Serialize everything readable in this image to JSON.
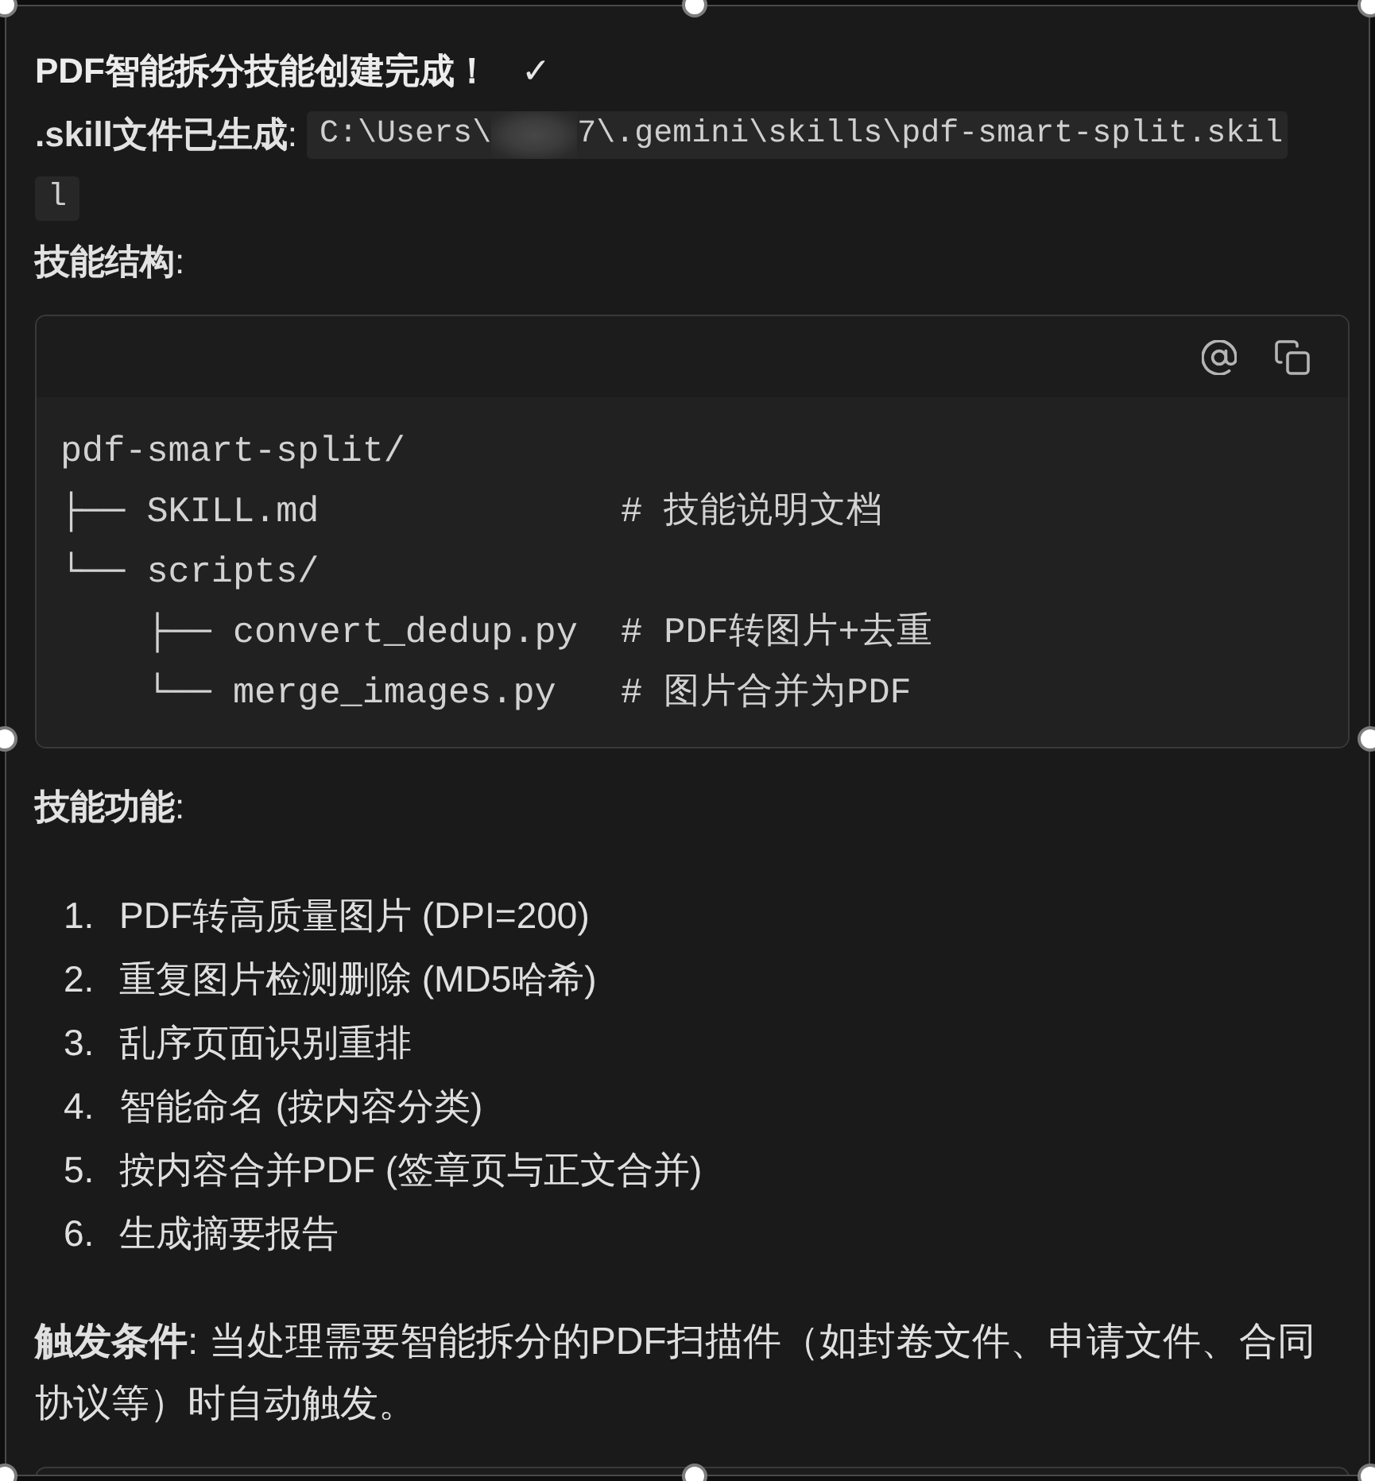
{
  "message": {
    "title": "PDF智能拆分技能创建完成！",
    "title_mark": "✓",
    "file_line": {
      "label": "**.skill文件已生成**:",
      "path_parts": [
        {
          "kind": "code",
          "text": "C:\\Users\\"
        },
        {
          "kind": "redacted"
        },
        {
          "kind": "code",
          "text": "7\\.gemini\\skills\\pdf-smart-split.skil"
        }
      ],
      "path_wrap": "l"
    },
    "structure_heading": "**技能结构**:",
    "code_block": {
      "lines": [
        "pdf-smart-split/",
        "├── SKILL.md              # 技能说明文档",
        "└── scripts/",
        "    ├── convert_dedup.py  # PDF转图片+去重",
        "    └── merge_images.py   # 图片合并为PDF"
      ]
    },
    "features_heading": "**技能功能**:",
    "features": [
      {
        "number": "1.",
        "text": "PDF转高质量图片 (DPI=200)"
      },
      {
        "number": "2.",
        "text": "重复图片检测删除 (MD5哈希)"
      },
      {
        "number": "3.",
        "text": "乱序页面识别重排"
      },
      {
        "number": "4.",
        "text": "智能命名 (按内容分类)"
      },
      {
        "number": "5.",
        "text": "按内容合并PDF (签章页与正文合并)"
      },
      {
        "number": "6.",
        "text": "生成摘要报告"
      }
    ],
    "trigger": "**触发条件**: 当处理需要智能拆分的PDF扫描件（如封卷文件、申请文件、合同协议等）时自动触发。"
  }
}
